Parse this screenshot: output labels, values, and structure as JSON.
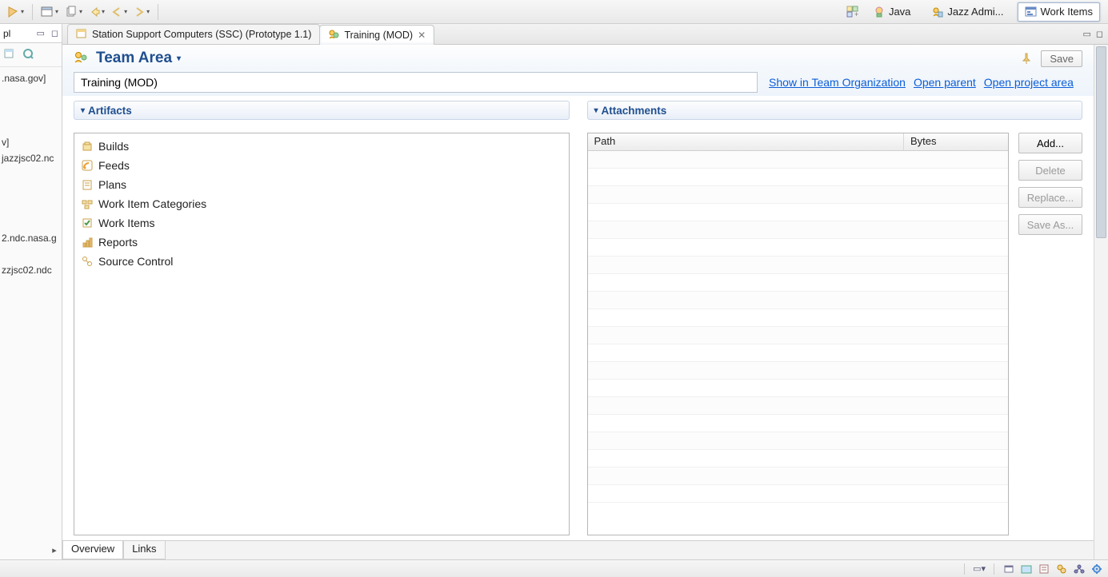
{
  "toolbar": {
    "perspectives": [
      {
        "label": "Java"
      },
      {
        "label": "Jazz Admi..."
      },
      {
        "label": "Work Items"
      }
    ]
  },
  "leftPane": {
    "tab": "pl",
    "fragments": [
      ".nasa.gov]",
      "",
      "",
      "v]",
      "jazzjsc02.nc",
      "",
      "",
      "",
      "2.ndc.nasa.g",
      "",
      "zzjsc02.ndc"
    ]
  },
  "editorTabs": {
    "inactive_label": "Station Support Computers (SSC) (Prototype 1.1)",
    "active_label": "Training (MOD)"
  },
  "teamArea": {
    "title": "Team Area",
    "save": "Save",
    "name_value": "Training (MOD)",
    "links": {
      "showTeamOrg": "Show in Team Organization",
      "openParent": "Open parent",
      "openProjectArea": "Open project area"
    }
  },
  "artifacts": {
    "header": "Artifacts",
    "items": [
      "Builds",
      "Feeds",
      "Plans",
      "Work Item Categories",
      "Work Items",
      "Reports",
      "Source Control"
    ]
  },
  "attachments": {
    "header": "Attachments",
    "col_path": "Path",
    "col_bytes": "Bytes",
    "buttons": {
      "add": "Add...",
      "delete": "Delete",
      "replace": "Replace...",
      "saveas": "Save As..."
    }
  },
  "editorBottomTabs": {
    "overview": "Overview",
    "links": "Links"
  }
}
